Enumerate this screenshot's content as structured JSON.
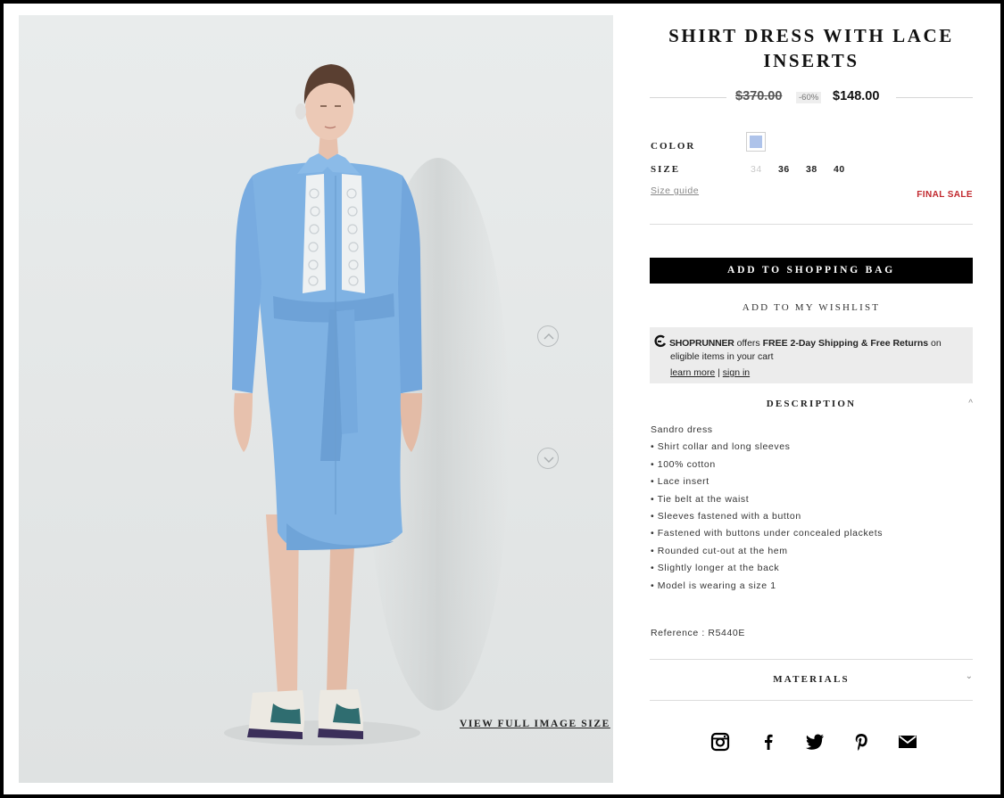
{
  "product": {
    "title": "SHIRT DRESS WITH LACE INSERTS",
    "price_original": "$370.00",
    "discount_badge": "-60%",
    "price_sale": "$148.00"
  },
  "options": {
    "color_label": "COLOR",
    "selected_color": "#aec3ea",
    "size_label": "SIZE",
    "sizes": [
      {
        "label": "34",
        "available": false
      },
      {
        "label": "36",
        "available": true
      },
      {
        "label": "38",
        "available": true
      },
      {
        "label": "40",
        "available": true
      }
    ],
    "size_guide": "Size guide",
    "final_sale": "FINAL SALE"
  },
  "actions": {
    "add_to_bag": "ADD TO SHOPPING BAG",
    "wishlist": "ADD TO MY WISHLIST"
  },
  "shoprunner": {
    "brand": "SHOPRUNNER",
    "text_a": " offers ",
    "text_bold": "FREE 2-Day Shipping & Free Returns",
    "text_b": " on",
    "line2": "eligible items in your cart",
    "learn_more": "learn more",
    "separator": " | ",
    "sign_in": "sign in"
  },
  "description": {
    "heading": "DESCRIPTION",
    "chevron": "^",
    "lines": [
      "Sandro dress",
      "• Shirt collar and long sleeves",
      "• 100% cotton",
      "• Lace insert",
      "• Tie belt at the waist",
      "• Sleeves fastened with a button",
      "• Fastened with buttons under concealed plackets",
      "• Rounded cut-out at the hem",
      "• Slightly longer at the back",
      "• Model is wearing a size 1"
    ],
    "reference": "Reference : R5440E"
  },
  "materials": {
    "heading": "MATERIALS",
    "chevron": "⌄"
  },
  "image": {
    "view_full": "VIEW FULL IMAGE SIZE",
    "prev_icon": "chevron-up-icon",
    "next_icon": "chevron-down-icon"
  },
  "social": [
    "instagram-icon",
    "facebook-icon",
    "twitter-icon",
    "pinterest-icon",
    "email-icon"
  ],
  "colors": {
    "accent": "#000000",
    "sale_red": "#c1272d",
    "dress_blue": "#7fb2e3"
  }
}
